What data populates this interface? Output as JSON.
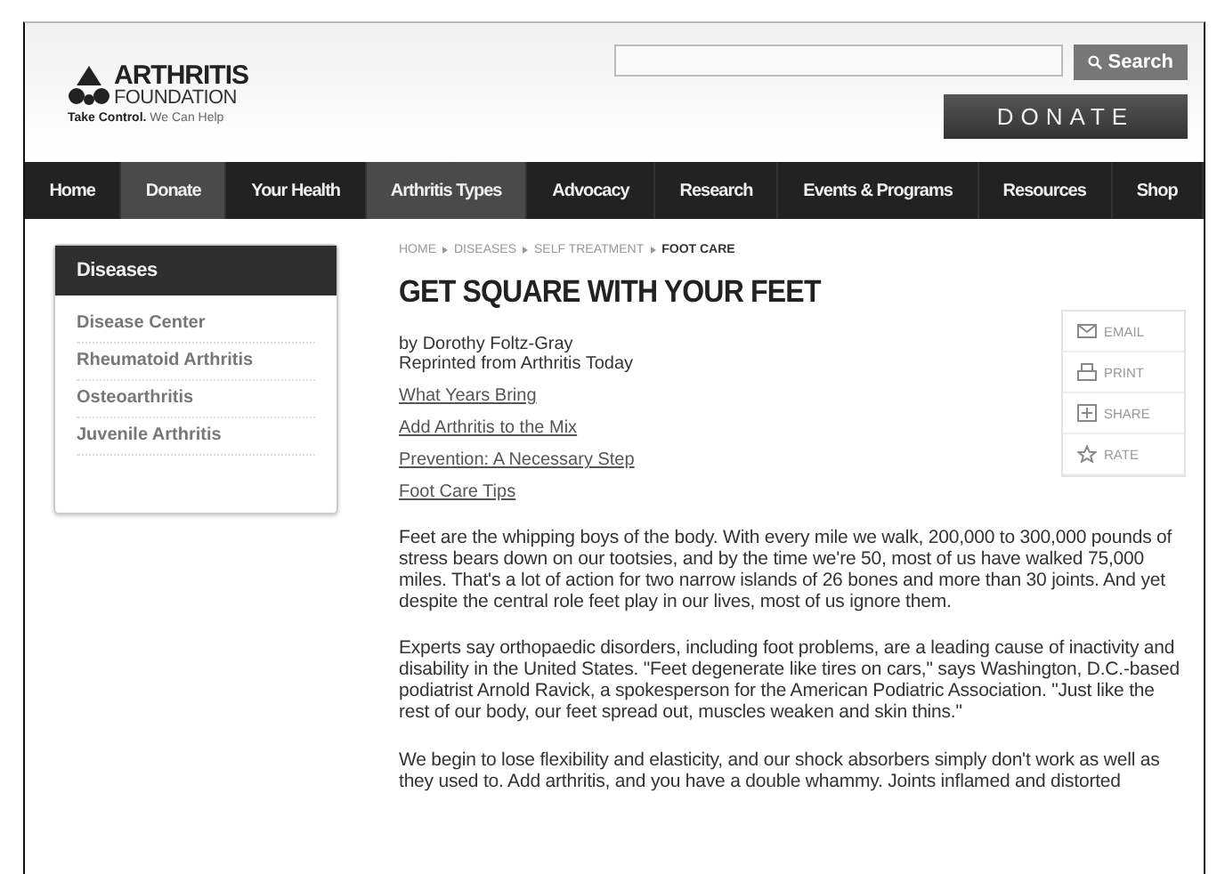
{
  "logo": {
    "name": "ARTHRITIS",
    "subname": "FOUNDATION",
    "tagline_bold": "Take Control.",
    "tagline": "We Can Help"
  },
  "search": {
    "button": "Search"
  },
  "donate_button": "DONATE",
  "nav": [
    {
      "label": "Home",
      "selected": false
    },
    {
      "label": "Donate",
      "selected": true
    },
    {
      "label": "Your Health",
      "selected": false
    },
    {
      "label": "Arthritis Types",
      "selected": true
    },
    {
      "label": "Advocacy",
      "selected": false
    },
    {
      "label": "Research",
      "selected": false
    },
    {
      "label": "Events & Programs",
      "selected": false
    },
    {
      "label": "Resources",
      "selected": false
    },
    {
      "label": "Shop",
      "selected": false
    }
  ],
  "sidebar": {
    "title": "Diseases",
    "items": [
      "Disease Center",
      "Rheumatoid Arthritis",
      "Osteoarthritis",
      "Juvenile Arthritis"
    ]
  },
  "breadcrumb": [
    "HOME",
    "DISEASES",
    "SELF TREATMENT",
    "FOOT CARE"
  ],
  "article": {
    "title": "GET SQUARE WITH YOUR FEET",
    "byline": "by Dorothy Foltz-Gray",
    "source": "Reprinted from Arthritis Today",
    "sections": [
      "What Years Bring",
      "Add Arthritis to the Mix",
      "Prevention: A Necessary Step",
      "Foot Care Tips"
    ],
    "paragraphs": [
      "Feet are the whipping boys of the body. With every mile we walk, 200,000 to 300,000 pounds of stress bears down on our tootsies, and by the time we're 50, most of us have walked 75,000 miles. That's a lot of action for two narrow islands of 26 bones and more than 30 joints. And yet despite the central role feet play in our lives, most of us ignore them.",
      "Experts say orthopaedic disorders, including foot problems, are a leading cause of inactivity and disability in the United States. \"Feet degenerate like tires on cars,\" says Washington, D.C.-based podiatrist Arnold Ravick, a spokesperson for the American Podiatric Association. \"Just like the rest of our body, our feet spread out, muscles weaken and skin thins.\"",
      "We begin to lose flexibility and elasticity, and our shock absorbers simply don't work as well as they used to. Add arthritis, and you have a double whammy. Joints inflamed and distorted"
    ]
  },
  "actions": [
    {
      "kind": "email",
      "label": "EMAIL"
    },
    {
      "kind": "print",
      "label": "PRINT"
    },
    {
      "kind": "share",
      "label": "SHARE"
    },
    {
      "kind": "rate",
      "label": "RATE"
    }
  ]
}
